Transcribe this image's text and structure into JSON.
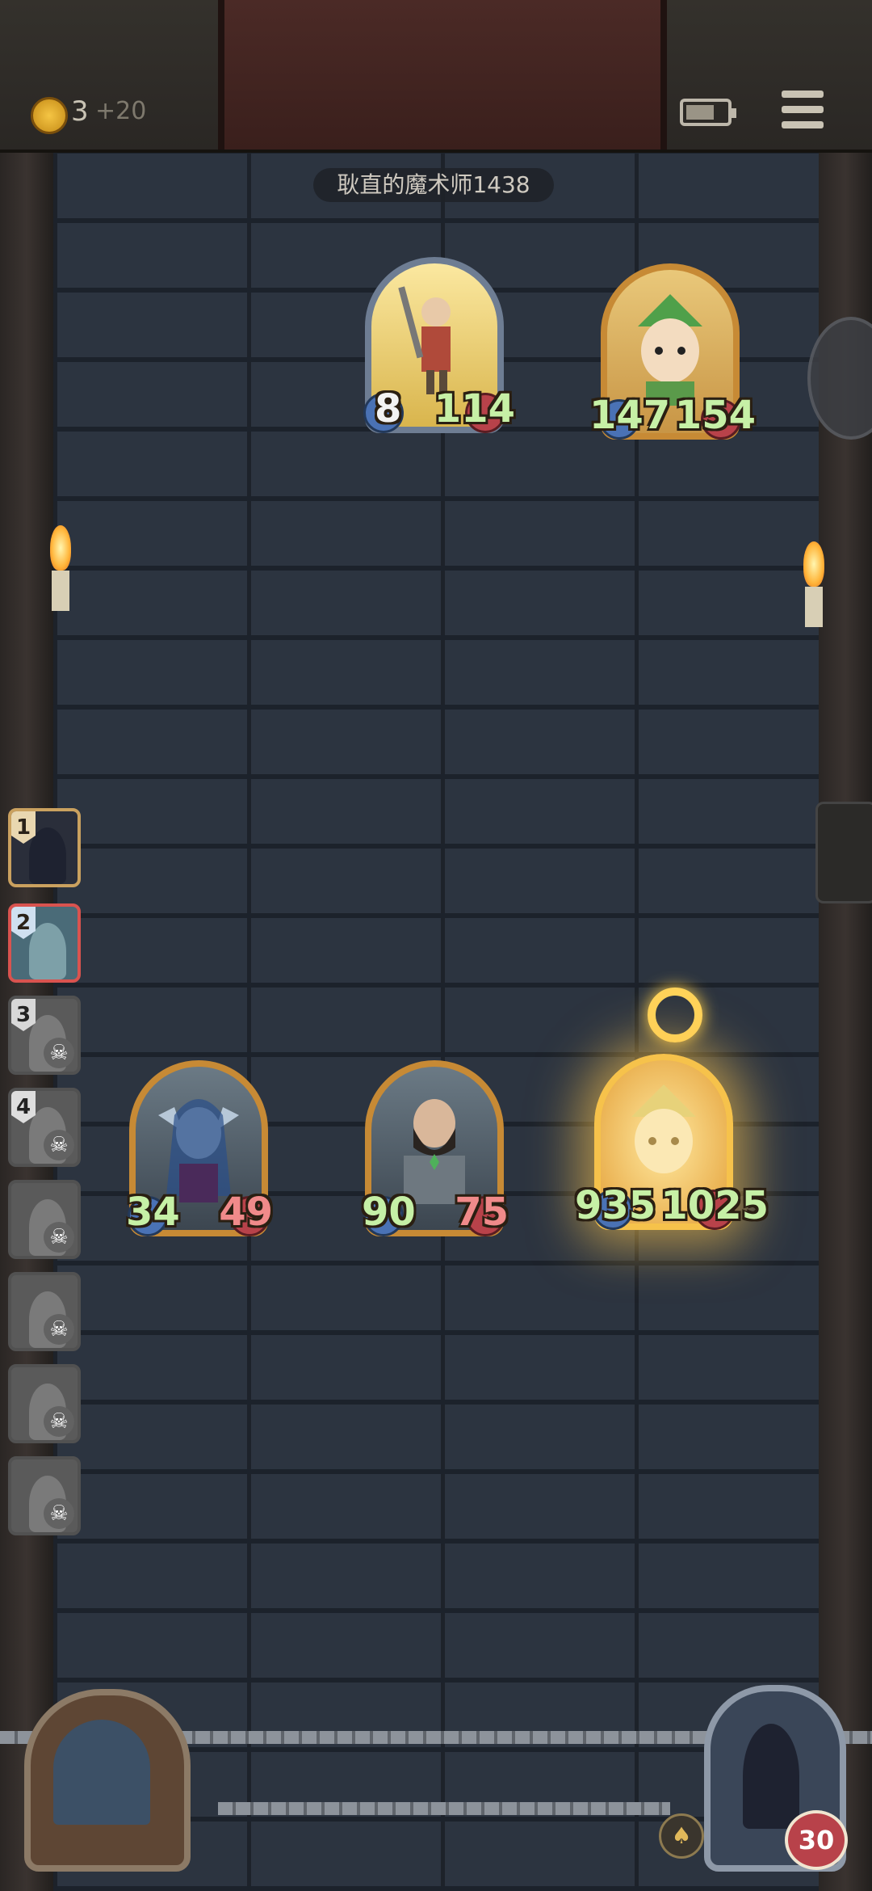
{
  "header": {
    "coins": "3",
    "coin_bonus": "+20",
    "icons": [
      "coin-icon",
      "battery-icon",
      "menu-icon"
    ]
  },
  "opponent": {
    "name": "耿直的魔术师1438",
    "minions": [
      {
        "atk": "8",
        "hp": "114"
      },
      {
        "atk": "147",
        "hp": "154"
      }
    ]
  },
  "player": {
    "minions": [
      {
        "atk": "34",
        "hp": "49"
      },
      {
        "atk": "90",
        "hp": "75"
      },
      {
        "atk": "935",
        "hp": "1025"
      }
    ],
    "hero_health": "30"
  },
  "roster": [
    {
      "rank": "1",
      "status": "active"
    },
    {
      "rank": "2",
      "status": "selected"
    },
    {
      "rank": "3",
      "status": "dead"
    },
    {
      "rank": "4",
      "status": "dead"
    },
    {
      "rank": "",
      "status": "dead"
    },
    {
      "rank": "",
      "status": "dead"
    },
    {
      "rank": "",
      "status": "dead"
    },
    {
      "rank": "",
      "status": "dead"
    }
  ],
  "colors": {
    "stat_green": "#c6f0a6",
    "gold_frame": "#c78a35",
    "health_red": "#b8424a",
    "attack_blue": "#4a72b5"
  }
}
